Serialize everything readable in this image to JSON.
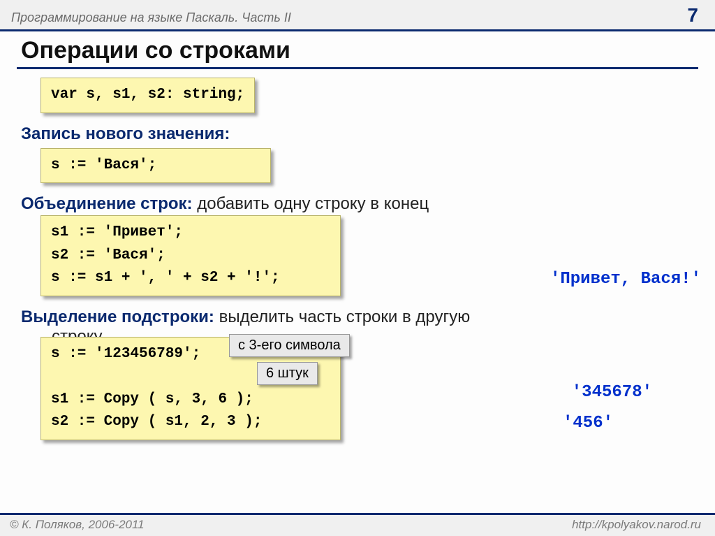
{
  "header": {
    "title": "Программирование на языке Паскаль. Часть II",
    "page": "7"
  },
  "slide_title": "Операции со строками",
  "decl_code": "var s, s1, s2: string;",
  "sec1": {
    "label": "Запись нового значения:"
  },
  "code1": "s := 'Вася';",
  "sec2": {
    "label": "Объединение строк: ",
    "cont": "добавить одну строку в конец"
  },
  "code2_l1": "s1 := 'Привет';",
  "code2_l2": "s2 := 'Вася';",
  "code2_l3": "s := s1 + ', ' + s2 + '!';",
  "result2": "'Привет, Вася!'",
  "sec3": {
    "label": "Выделение подстроки: ",
    "cont1": "выделить часть строки в другую",
    "cont2": "строку"
  },
  "code3_l1": "s := '123456789';",
  "code3_l2": "",
  "code3_l3": "s1 := Copy ( s, 3, 6 );",
  "code3_l4": "s2 := Copy ( s1, 2, 3 );",
  "callout1": "с 3-его символа",
  "callout2": "6 штук",
  "result3a": "'345678'",
  "result3b": "'456'",
  "footer": {
    "left": "© К. Поляков, 2006-2011",
    "right": "http://kpolyakov.narod.ru"
  }
}
